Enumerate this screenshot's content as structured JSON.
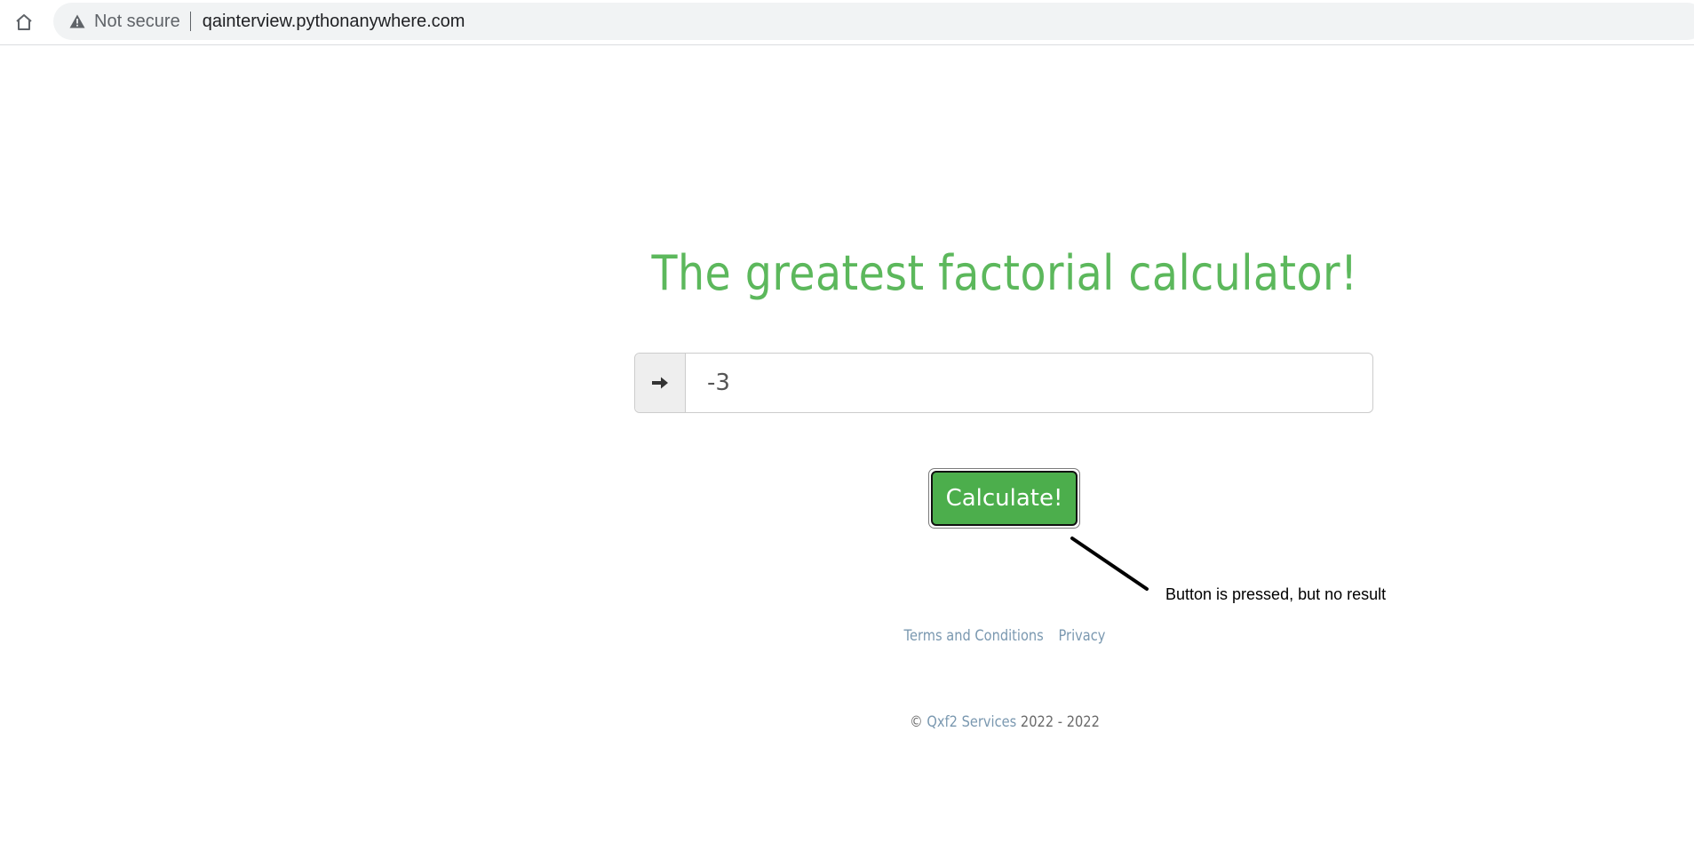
{
  "browser": {
    "security_label": "Not secure",
    "url": "qainterview.pythonanywhere.com",
    "icons": {
      "home": "home-icon",
      "security": "warning-triangle-icon"
    }
  },
  "page": {
    "title": "The greatest factorial calculator!",
    "input": {
      "value": "-3",
      "addon_icon": "arrow-right-icon"
    },
    "calculate_button": "Calculate!",
    "annotation": "Button is pressed, but no result",
    "footer_links": {
      "terms": "Terms and Conditions",
      "privacy": "Privacy"
    },
    "copyright": {
      "symbol": "©",
      "company": "Qxf2 Services",
      "years": "2022 - 2022"
    }
  },
  "colors": {
    "title_green": "#5cb85c",
    "button_green": "#4cae4c",
    "link_blue": "#7a98b0"
  }
}
